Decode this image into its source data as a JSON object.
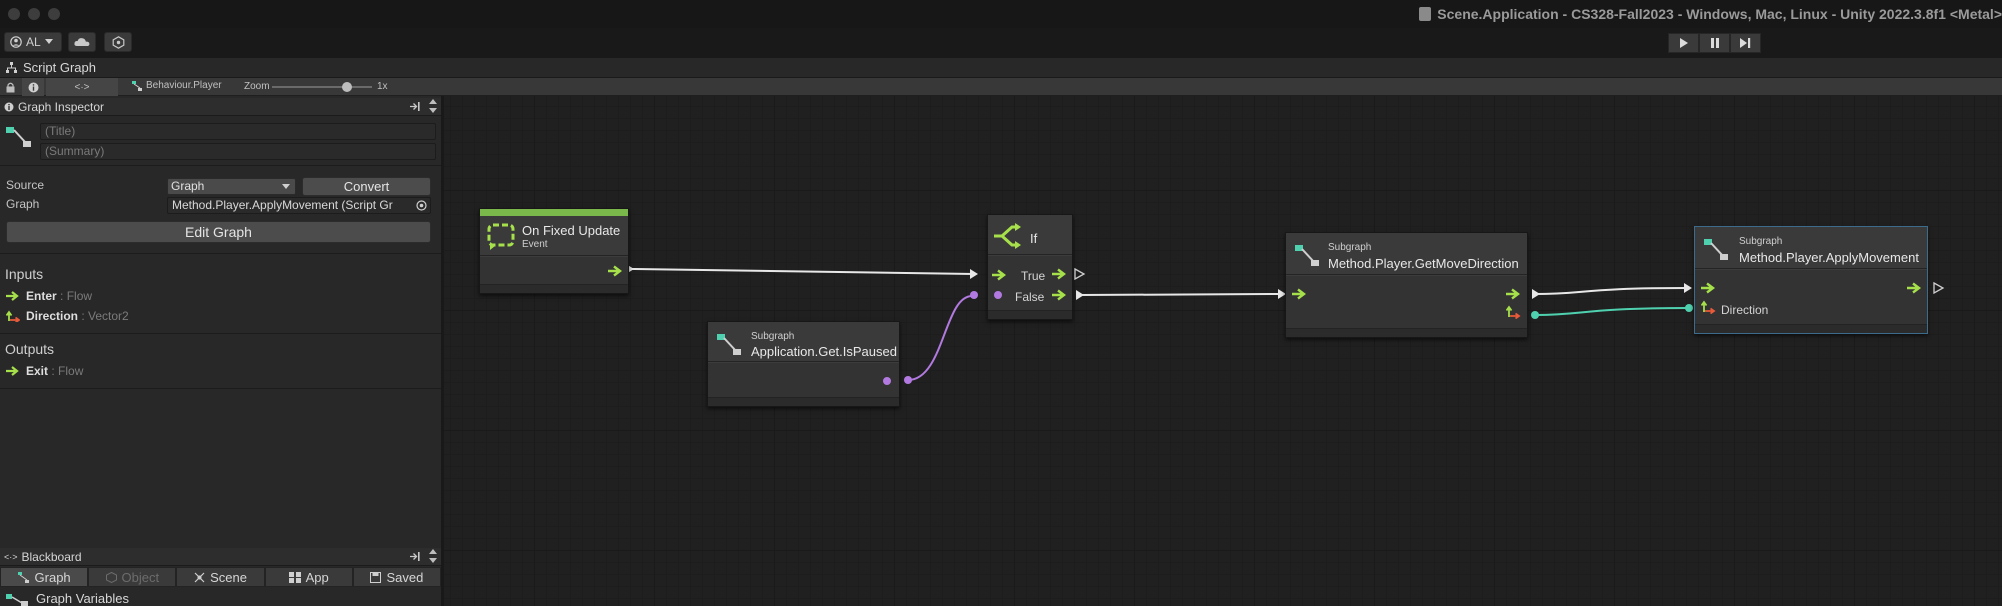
{
  "window": {
    "title": "Scene.Application - CS328-Fall2023 - Windows, Mac, Linux - Unity 2022.3.8f1 <Metal>"
  },
  "toolbar": {
    "account_label": "AL",
    "play_icon": "play-icon",
    "pause_icon": "pause-icon",
    "step_icon": "step-icon"
  },
  "script_graph": {
    "window_label": "Script Graph",
    "breadcrumb": "Behaviour.Player",
    "zoom_label": "Zoom",
    "zoom_value": "1x",
    "zoom_fraction": 1.0
  },
  "inspector": {
    "header": "Graph Inspector",
    "title_placeholder": "(Title)",
    "summary_placeholder": "(Summary)",
    "source_label": "Source",
    "source_value": "Graph",
    "convert_label": "Convert",
    "graph_label": "Graph",
    "graph_value": "Method.Player.ApplyMovement (Script Gr",
    "edit_graph_label": "Edit Graph",
    "inputs_heading": "Inputs",
    "inputs": [
      {
        "name": "Enter",
        "type": ": Flow"
      },
      {
        "name": "Direction",
        "type": ": Vector2"
      }
    ],
    "outputs_heading": "Outputs",
    "outputs": [
      {
        "name": "Exit",
        "type": ": Flow"
      }
    ]
  },
  "blackboard": {
    "header": "Blackboard",
    "tabs": [
      {
        "label": "Graph",
        "active": true
      },
      {
        "label": "Object",
        "active": false
      },
      {
        "label": "Scene",
        "active": false
      },
      {
        "label": "App",
        "active": false
      },
      {
        "label": "Saved",
        "active": false
      }
    ],
    "section_label": "Graph Variables"
  },
  "nodes": {
    "on_fixed_update": {
      "title": "On Fixed Update",
      "subtitle": "Event"
    },
    "if_node": {
      "title": "If",
      "true_label": "True",
      "false_label": "False"
    },
    "is_paused": {
      "kind": "Subgraph",
      "title": "Application.Get.IsPaused"
    },
    "get_move_direction": {
      "kind": "Subgraph",
      "title": "Method.Player.GetMoveDirection"
    },
    "apply_movement": {
      "kind": "Subgraph",
      "title": "Method.Player.ApplyMovement",
      "direction_label": "Direction"
    }
  },
  "colors": {
    "flow": "#a6e04a",
    "bool": "#b27ae0",
    "vector2": "#4fd1b0",
    "event_bar": "#7ab84c",
    "wire_white": "#e8e8e8"
  }
}
